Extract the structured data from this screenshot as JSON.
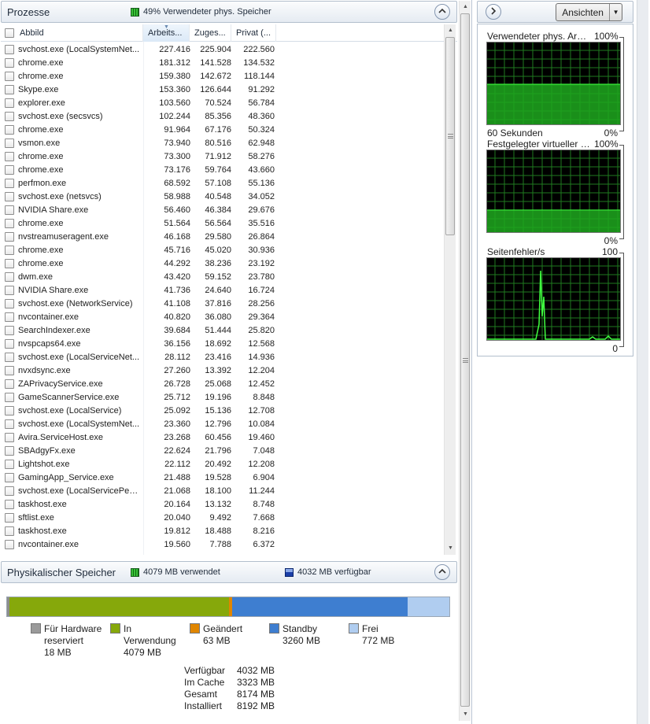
{
  "processes": {
    "title": "Prozesse",
    "status": "49% Verwendeter phys. Speicher",
    "collapse_icon": "chevron-up-icon",
    "columns": [
      "Abbild",
      "Arbeits...",
      "Zuges...",
      "Privat (..."
    ],
    "sorted_column": "Arbeits...",
    "rows": [
      [
        "svchost.exe (LocalSystemNet...",
        "227.416",
        "225.904",
        "222.560"
      ],
      [
        "chrome.exe",
        "181.312",
        "141.528",
        "134.532"
      ],
      [
        "chrome.exe",
        "159.380",
        "142.672",
        "118.144"
      ],
      [
        "Skype.exe",
        "153.360",
        "126.644",
        "91.292"
      ],
      [
        "explorer.exe",
        "103.560",
        "70.524",
        "56.784"
      ],
      [
        "svchost.exe (secsvcs)",
        "102.244",
        "85.356",
        "48.360"
      ],
      [
        "chrome.exe",
        "91.964",
        "67.176",
        "50.324"
      ],
      [
        "vsmon.exe",
        "73.940",
        "80.516",
        "62.948"
      ],
      [
        "chrome.exe",
        "73.300",
        "71.912",
        "58.276"
      ],
      [
        "chrome.exe",
        "73.176",
        "59.764",
        "43.660"
      ],
      [
        "perfmon.exe",
        "68.592",
        "57.108",
        "55.136"
      ],
      [
        "svchost.exe (netsvcs)",
        "58.988",
        "40.548",
        "34.052"
      ],
      [
        "NVIDIA Share.exe",
        "56.460",
        "46.384",
        "29.676"
      ],
      [
        "chrome.exe",
        "51.564",
        "56.564",
        "35.516"
      ],
      [
        "nvstreamuseragent.exe",
        "46.168",
        "29.580",
        "26.864"
      ],
      [
        "chrome.exe",
        "45.716",
        "45.020",
        "30.936"
      ],
      [
        "chrome.exe",
        "44.292",
        "38.236",
        "23.192"
      ],
      [
        "dwm.exe",
        "43.420",
        "59.152",
        "23.780"
      ],
      [
        "NVIDIA Share.exe",
        "41.736",
        "24.640",
        "16.724"
      ],
      [
        "svchost.exe (NetworkService)",
        "41.108",
        "37.816",
        "28.256"
      ],
      [
        "nvcontainer.exe",
        "40.820",
        "36.080",
        "29.364"
      ],
      [
        "SearchIndexer.exe",
        "39.684",
        "51.444",
        "25.820"
      ],
      [
        "nvspcaps64.exe",
        "36.156",
        "18.692",
        "12.568"
      ],
      [
        "svchost.exe (LocalServiceNet...",
        "28.112",
        "23.416",
        "14.936"
      ],
      [
        "nvxdsync.exe",
        "27.260",
        "13.392",
        "12.204"
      ],
      [
        "ZAPrivacyService.exe",
        "26.728",
        "25.068",
        "12.452"
      ],
      [
        "GameScannerService.exe",
        "25.712",
        "19.196",
        "8.848"
      ],
      [
        "svchost.exe (LocalService)",
        "25.092",
        "15.136",
        "12.708"
      ],
      [
        "svchost.exe (LocalSystemNet...",
        "23.360",
        "12.796",
        "10.084"
      ],
      [
        "Avira.ServiceHost.exe",
        "23.268",
        "60.456",
        "19.460"
      ],
      [
        "SBAdgyFx.exe",
        "22.624",
        "21.796",
        "7.048"
      ],
      [
        "Lightshot.exe",
        "22.112",
        "20.492",
        "12.208"
      ],
      [
        "GamingApp_Service.exe",
        "21.488",
        "19.528",
        "6.904"
      ],
      [
        "svchost.exe (LocalServicePee...",
        "21.068",
        "18.100",
        "11.244"
      ],
      [
        "taskhost.exe",
        "20.164",
        "13.132",
        "8.748"
      ],
      [
        "sftlist.exe",
        "20.040",
        "9.492",
        "7.668"
      ],
      [
        "taskhost.exe",
        "19.812",
        "18.488",
        "8.216"
      ],
      [
        "nvcontainer.exe",
        "19.560",
        "7.788",
        "6.372"
      ]
    ]
  },
  "memory": {
    "title": "Physikalischer Speicher",
    "used_status": "4079 MB verwendet",
    "available_status": "4032 MB verfügbar",
    "collapse_icon": "chevron-up-icon",
    "bar": [
      {
        "name": "Für Hardware reserviert",
        "mb": 18,
        "color": "#8d8d8d"
      },
      {
        "name": "In Verwendung",
        "mb": 4079,
        "color": "#86a80b"
      },
      {
        "name": "Geändert",
        "mb": 63,
        "color": "#e08600"
      },
      {
        "name": "Standby",
        "mb": 3260,
        "color": "#3e7ed0"
      },
      {
        "name": "Frei",
        "mb": 772,
        "color": "#b0cdf0"
      }
    ],
    "legend": [
      {
        "line1": "Für Hardware",
        "line2": "reserviert",
        "value": "18 MB",
        "color": "#9a9a9a"
      },
      {
        "line1": "In",
        "line2": "Verwendung",
        "value": "4079 MB",
        "color": "#86a80b"
      },
      {
        "line1": "Geändert",
        "line2": "",
        "value": "63 MB",
        "color": "#e08600"
      },
      {
        "line1": "Standby",
        "line2": "",
        "value": "3260 MB",
        "color": "#3e7ed0"
      },
      {
        "line1": "Frei",
        "line2": "",
        "value": "772 MB",
        "color": "#b0cdf0"
      }
    ],
    "summary": [
      {
        "label": "Verfügbar",
        "value": "4032 MB"
      },
      {
        "label": "Im Cache",
        "value": "3323 MB"
      },
      {
        "label": "Gesamt",
        "value": "8174 MB"
      },
      {
        "label": "Installiert",
        "value": "8192 MB"
      }
    ]
  },
  "right_panel": {
    "expand_icon": "chevron-right-icon",
    "views_button": "Ansichten",
    "views_dropdown_icon": "dropdown-arrow-icon",
    "graphs": [
      {
        "title": "Verwendeter phys. Arbe...",
        "max_label": "100%",
        "time_label": "60 Sekunden",
        "min_label": "0%",
        "level_percent": 49
      },
      {
        "title": "Festgelegter virtueller S...",
        "max_label": "100%",
        "time_label": "",
        "min_label": "0%",
        "level_percent": 27
      },
      {
        "title": "Seitenfehler/s",
        "max_label": "100",
        "time_label": "",
        "min_label": "0",
        "level_percent": 0
      }
    ]
  }
}
